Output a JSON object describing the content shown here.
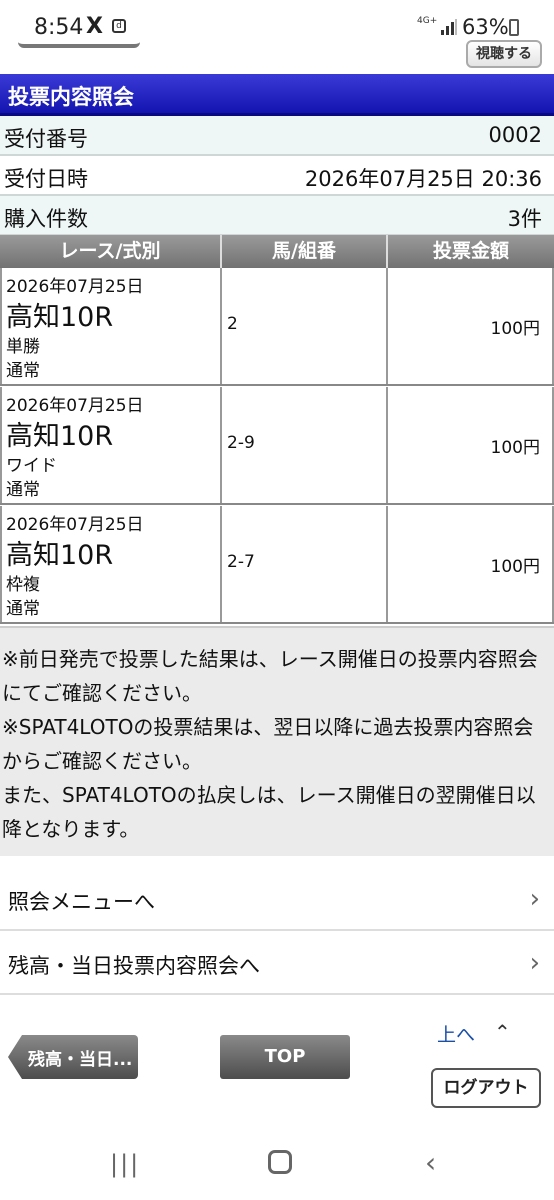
{
  "status_bar": {
    "time": "8:54",
    "x_icon": "X",
    "d_icon": "d",
    "network": "4G+",
    "battery": "63%"
  },
  "header": {
    "view_button": "視聴する",
    "title": "投票内容照会"
  },
  "info": [
    {
      "label": "受付番号",
      "value": "0002"
    },
    {
      "label": "受付日時",
      "value": "2026年07月25日 20:36"
    },
    {
      "label": "購入件数",
      "value": "3件"
    }
  ],
  "table": {
    "headers": [
      "レース/式別",
      "馬/組番",
      "投票金額"
    ],
    "rows": [
      {
        "date": "2026年07月25日",
        "venue": "高知10R",
        "bet_type": "単勝",
        "mode": "通常",
        "number": "2",
        "amount": "100円"
      },
      {
        "date": "2026年07月25日",
        "venue": "高知10R",
        "bet_type": "ワイド",
        "mode": "通常",
        "number": "2-9",
        "amount": "100円"
      },
      {
        "date": "2026年07月25日",
        "venue": "高知10R",
        "bet_type": "枠複",
        "mode": "通常",
        "number": "2-7",
        "amount": "100円"
      }
    ]
  },
  "notes": [
    "※前日発売で投票した結果は、レース開催日の投票内容照会にてご確認ください。",
    "※SPAT4LOTOの投票結果は、翌日以降に過去投票内容照会からご確認ください。",
    "また、SPAT4LOTOの払戻しは、レース開催日の翌開催日以降となります。"
  ],
  "menu": [
    {
      "label": "照会メニューへ"
    },
    {
      "label": "残高・当日投票内容照会へ"
    }
  ],
  "nav": {
    "back_label": "残高・当日...",
    "top_label": "TOP",
    "up_label": "上へ",
    "logout_label": "ログアウト"
  }
}
